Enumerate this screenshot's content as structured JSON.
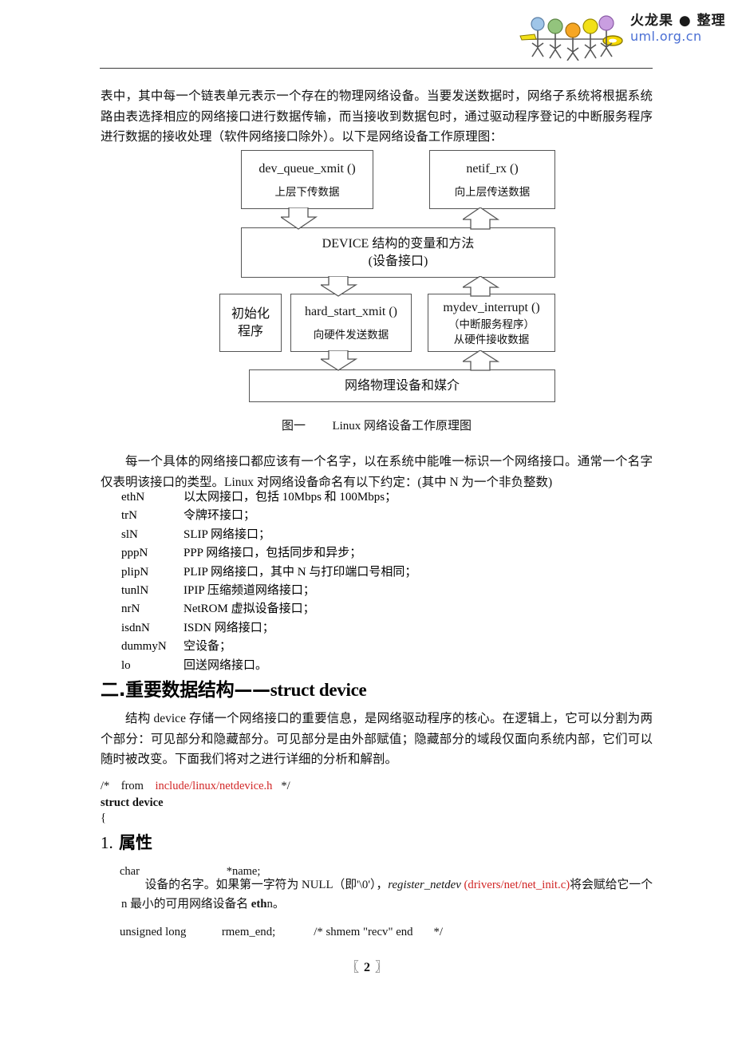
{
  "header": {
    "brand_cn": "火龙果 ● 整理",
    "brand_url": "uml.org.cn",
    "logo_icon": "stick-figures-logo",
    "logo_head_colors": [
      "#9fc5e8",
      "#93c47d",
      "#f6a623",
      "#f2e018",
      "#c99ee0"
    ]
  },
  "paragraphs": {
    "intro": "表中，其中每一个链表单元表示一个存在的物理网络设备。当要发送数据时，网络子系统将根据系统路由表选择相应的网络接口进行数据传输，而当接收到数据包时，通过驱动程序登记的中断服务程序进行数据的接收处理（软件网络接口除外）。以下是网络设备工作原理图：",
    "naming": "每一个具体的网络接口都应该有一个名字，以在系统中能唯一标识一个网络接口。通常一个名字仅表明该接口的类型。Linux 对网络设备命名有以下约定：(其中 N 为一个非负整数)",
    "struct_intro": "结构 device 存储一个网络接口的重要信息，是网络驱动程序的核心。在逻辑上，它可以分割为两个部分：可见部分和隐藏部分。可见部分是由外部赋值；隐藏部分的域段仅面向系统内部，它们可以随时被改变。下面我们将对之进行详细的分析和解剖。"
  },
  "diagram": {
    "boxes": {
      "dev_queue_xmit": {
        "title": "dev_queue_xmit ()",
        "subtitle": "上层下传数据"
      },
      "netif_rx": {
        "title": "netif_rx ()",
        "subtitle": "向上层传送数据"
      },
      "device_struct": {
        "title": "DEVICE 结构的变量和方法",
        "subtitle": "(设备接口)"
      },
      "init": {
        "line1": "初始化",
        "line2": "程序"
      },
      "hard_start_xmit": {
        "title": "hard_start_xmit ()",
        "subtitle": "向硬件发送数据"
      },
      "mydev_interrupt": {
        "title": "mydev_interrupt ()",
        "subtitle1": "（中断服务程序）",
        "subtitle2": "从硬件接收数据"
      },
      "physical": {
        "title": "网络物理设备和媒介"
      }
    },
    "caption_label": "图一",
    "caption_text": "Linux 网络设备工作原理图"
  },
  "device_names": [
    {
      "name": "ethN",
      "desc": "以太网接口，包括 10Mbps 和 100Mbps；"
    },
    {
      "name": "trN",
      "desc": "令牌环接口；"
    },
    {
      "name": "slN",
      "desc": "SLIP 网络接口；"
    },
    {
      "name": "pppN",
      "desc": "PPP 网络接口，包括同步和异步；"
    },
    {
      "name": "plipN",
      "desc": "PLIP 网络接口，其中 N 与打印端口号相同；"
    },
    {
      "name": "tunlN",
      "desc": "IPIP 压缩频道网络接口；"
    },
    {
      "name": "nrN",
      "desc": "NetROM 虚拟设备接口；"
    },
    {
      "name": "isdnN",
      "desc": "ISDN 网络接口；"
    },
    {
      "name": "dummyN",
      "desc": "空设备；"
    },
    {
      "name": "lo",
      "desc": "回送网络接口。"
    }
  ],
  "headings": {
    "section2_cn": "二.重要数据结构——",
    "section2_latin": "struct device",
    "attr_num": "1.",
    "attr_title": "属性"
  },
  "code": {
    "comment_open": "/*    from    ",
    "comment_path": "include/linux/netdevice.h",
    "comment_close": "   */",
    "struct_decl": "struct device",
    "open_brace": "{",
    "char_name_line": "char                              *name;",
    "rmem_line": "unsigned long            rmem_end;             /* shmem \"recv\" end       */"
  },
  "attr_desc": {
    "part1": "设备的名字。如果第一字符为 NULL（即'\\0'），",
    "ital": "register_netdev ",
    "path": "(drivers/net/net_init.c)",
    "part2": "将会赋给它一个 n 最小的可用网络设备名 ",
    "bold_eth": "eth",
    "part3": "n。"
  },
  "footer": {
    "bracket_left": "〖",
    "page_number": "2",
    "bracket_right": "〗"
  },
  "colors": {
    "link_red": "#d12626",
    "brand_blue": "#4a6fd4",
    "rule": "#3a3a3a"
  }
}
